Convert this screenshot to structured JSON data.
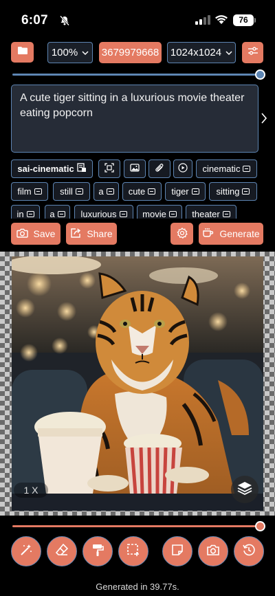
{
  "status_bar": {
    "time": "6:07",
    "battery": "76"
  },
  "toolbar": {
    "zoom_value": "100%",
    "seed_value": "3679979668",
    "size_value": "1024x1024"
  },
  "top_slider": {
    "level": 1.0,
    "color": "#5e86b4"
  },
  "prompt": {
    "text": "A cute tiger sitting in a luxurious movie theater eating popcorn"
  },
  "chips": {
    "style": "sai-cinematic",
    "tag_cinematic": "cinematic",
    "tags_row2": [
      "film",
      "still",
      "a",
      "cute",
      "tiger",
      "sitting"
    ],
    "tags_row3": [
      "in",
      "a",
      "luxurious",
      "movie",
      "theater"
    ]
  },
  "actions": {
    "save_label": "Save",
    "share_label": "Share",
    "generate_label": "Generate"
  },
  "canvas": {
    "zoom_label": "1 X"
  },
  "bottom_slider": {
    "level": 1.0,
    "color": "#e47a62"
  },
  "footer": {
    "status": "Generated in 39.77s."
  },
  "colors": {
    "accent": "#e47a62",
    "outline": "#5e86b4",
    "background": "#000000"
  },
  "icons": [
    "folder-icon",
    "chevron-down-icon",
    "sliders-icon",
    "chevron-right-icon",
    "camera-icon",
    "share-icon",
    "gear-icon",
    "cup-icon",
    "layers-icon",
    "magic-wand-icon",
    "eraser-icon",
    "paint-roller-icon",
    "crop-select-icon",
    "note-icon",
    "camera-icon",
    "history-icon"
  ]
}
